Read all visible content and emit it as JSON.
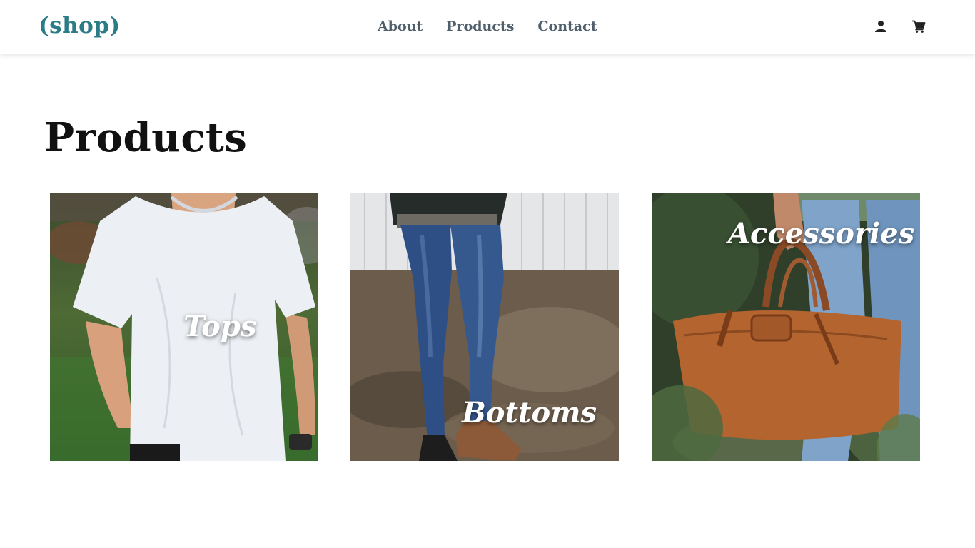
{
  "header": {
    "logo": "(shop)",
    "nav": [
      {
        "label": "About"
      },
      {
        "label": "Products"
      },
      {
        "label": "Contact"
      }
    ],
    "icons": [
      "user-icon",
      "cart-icon"
    ]
  },
  "main": {
    "title": "Products",
    "categories": [
      {
        "label": "Tops",
        "image": "white-tshirt-photo"
      },
      {
        "label": "Bottoms",
        "image": "jeans-photo"
      },
      {
        "label": "Accessories",
        "image": "leather-bag-photo"
      }
    ]
  },
  "colors": {
    "brand": "#2b7c86",
    "nav_text": "#4f5e6b",
    "title": "#111111",
    "tile_label": "#ffffff"
  }
}
